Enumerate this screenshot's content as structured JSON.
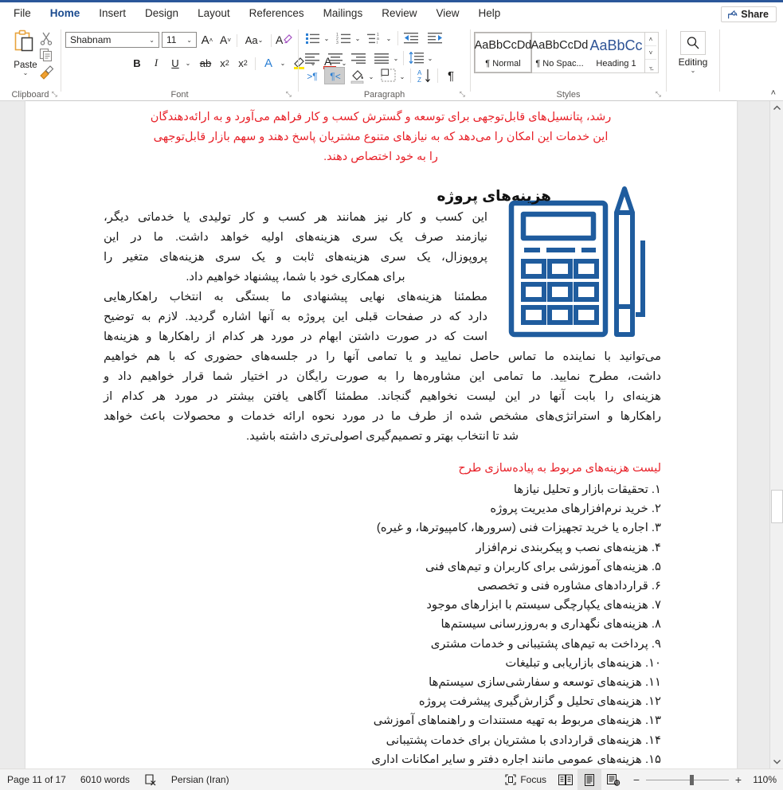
{
  "window": {
    "accent_color": "#2b579a"
  },
  "ribbon": {
    "tabs": [
      {
        "label": "File",
        "active": false
      },
      {
        "label": "Home",
        "active": true
      },
      {
        "label": "Insert",
        "active": false
      },
      {
        "label": "Design",
        "active": false
      },
      {
        "label": "Layout",
        "active": false
      },
      {
        "label": "References",
        "active": false
      },
      {
        "label": "Mailings",
        "active": false
      },
      {
        "label": "Review",
        "active": false
      },
      {
        "label": "View",
        "active": false
      },
      {
        "label": "Help",
        "active": false
      }
    ],
    "share_label": "Share",
    "groups": {
      "clipboard": {
        "label": "Clipboard",
        "paste_label": "Paste"
      },
      "font": {
        "label": "Font",
        "font_name": "Shabnam",
        "font_size": "11"
      },
      "paragraph": {
        "label": "Paragraph"
      },
      "styles": {
        "label": "Styles",
        "items": [
          {
            "preview": "AaBbCcDd",
            "name": "¶ Normal",
            "selected": true
          },
          {
            "preview": "AaBbCcDd",
            "name": "¶ No Spac...",
            "selected": false
          },
          {
            "preview": "AaBbCc",
            "name": "Heading 1",
            "selected": false
          }
        ]
      },
      "editing": {
        "label": "Editing"
      }
    }
  },
  "document": {
    "red_intro": [
      "رشد، پتانسیل‌های قابل‌توجهی برای توسعه و گسترش کسب و کار فراهم می‌آورد و به ارائه‌دهندگان",
      "این خدمات این امکان را می‌دهد که به نیازهای متنوع مشتریان پاسخ دهند و سهم بازار قابل‌توجهی",
      "را به خود اختصاص دهند."
    ],
    "heading": "هزینه‌های پروژه",
    "body_narrow": [
      "این کسب و کار نیز همانند هر کسب و کار تولیدی یا خدماتی دیگر،",
      "نیازمند صرف یک سری هزینه‌های اولیه خواهد داشت. ما در این",
      "پروپوزال، یک سری هزینه‌های ثابت و یک سری هزینه‌های متغیر را",
      "برای همکاری خود با شما، پیشنهاد خواهیم داد.",
      "مطمئنا هزینه‌های نهایی پیشنهادی ما بستگی به انتخاب راهکارهایی",
      "دارد که در صفحات قبلی این پروژه به آنها اشاره گردید. لازم به توضیح",
      "است که در صورت داشتن ابهام در مورد هر کدام از راهکارها و هزینه‌ها"
    ],
    "body_wide": [
      "می‌توانید با نماینده ما تماس حاصل نمایید و یا تمامی آنها را در جلسه‌های حضوری که با هم خواهیم",
      "داشت، مطرح نمایید. ما تمامی این مشاوره‌ها را به صورت رایگان در اختیار شما قرار خواهیم داد و",
      "هزینه‌ای را بابت آنها در این لیست نخواهیم گنجاند. مطمئنا آگاهی یافتن بیشتر در مورد هر کدام از",
      "راهکارها و استراتژی‌های مشخص شده از طرف ما در مورد نحوه ارائه خدمات و محصولات باعث خواهد",
      "شد تا انتخاب بهتر و تصمیم‌گیری اصولی‌تری داشته باشید."
    ],
    "list_title": "لیست هزینه‌های مربوط به پیاده‌سازی طرح",
    "list_items": [
      "۱. تحقیقات بازار و تحلیل نیازها",
      "۲. خرید نرم‌افزارهای مدیریت پروژه",
      "۳. اجاره یا خرید تجهیزات فنی (سرورها، کامپیوترها، و غیره)",
      "۴. هزینه‌های نصب و پیکربندی نرم‌افزار",
      "۵. هزینه‌های آموزشی برای کاربران و تیم‌های فنی",
      "۶. قراردادهای مشاوره فنی و تخصصی",
      "۷. هزینه‌های یکپارچگی سیستم با ابزارهای موجود",
      "۸. هزینه‌های نگهداری و به‌روزرسانی سیستم‌ها",
      "۹. پرداخت به تیم‌های پشتیبانی و خدمات مشتری",
      "۱۰. هزینه‌های بازاریابی و تبلیغات",
      "۱۱. هزینه‌های توسعه و سفارشی‌سازی سیستم‌ها",
      "۱۲. هزینه‌های تحلیل و گزارش‌گیری پیشرفت پروژه",
      "۱۳. هزینه‌های مربوط به تهیه مستندات و راهنماهای آموزشی",
      "۱۴. هزینه‌های قراردادی با مشتریان برای خدمات پشتیبانی",
      "۱۵. هزینه‌های عمومی مانند اجاره دفتر و سایر امکانات اداری"
    ],
    "image_color": "#1f5c9e",
    "text_color_red": "#e8222a"
  },
  "status_bar": {
    "page": "Page 11 of 17",
    "words": "6010 words",
    "language": "Persian (Iran)",
    "focus": "Focus",
    "zoom": "110%"
  }
}
